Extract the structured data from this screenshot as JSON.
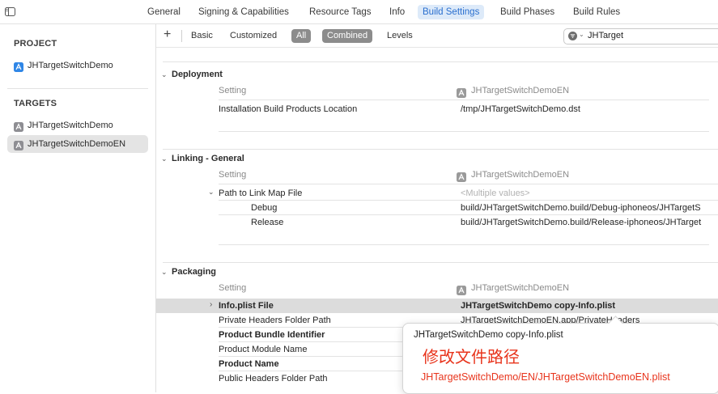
{
  "toolbar": {
    "tabs": [
      {
        "label": "General"
      },
      {
        "label": "Signing & Capabilities"
      },
      {
        "label": "Resource Tags"
      },
      {
        "label": "Info"
      },
      {
        "label": "Build Settings"
      },
      {
        "label": "Build Phases"
      },
      {
        "label": "Build Rules"
      }
    ],
    "active_tab": "Build Settings"
  },
  "sidebar": {
    "project_heading": "PROJECT",
    "project_item": "JHTargetSwitchDemo",
    "targets_heading": "TARGETS",
    "targets": [
      {
        "label": "JHTargetSwitchDemo"
      },
      {
        "label": "JHTargetSwitchDemoEN"
      }
    ],
    "selected_target": "JHTargetSwitchDemoEN"
  },
  "filter": {
    "add_label": "+",
    "basic": "Basic",
    "customized": "Customized",
    "all": "All",
    "combined": "Combined",
    "levels": "Levels",
    "search_value": "JHTarget"
  },
  "sections": {
    "deployment": {
      "title": "Deployment",
      "setting_header": "Setting",
      "target_header": "JHTargetSwitchDemoEN",
      "rows": [
        {
          "name": "Installation Build Products Location",
          "value": "/tmp/JHTargetSwitchDemo.dst"
        }
      ]
    },
    "linking": {
      "title": "Linking - General",
      "setting_header": "Setting",
      "target_header": "JHTargetSwitchDemoEN",
      "rows": [
        {
          "name": "Path to Link Map File",
          "value": "<Multiple values>"
        },
        {
          "name": "Debug",
          "value": "build/JHTargetSwitchDemo.build/Debug-iphoneos/JHTargetS"
        },
        {
          "name": "Release",
          "value": "build/JHTargetSwitchDemo.build/Release-iphoneos/JHTarget"
        }
      ]
    },
    "packaging": {
      "title": "Packaging",
      "setting_header": "Setting",
      "target_header": "JHTargetSwitchDemoEN",
      "rows": [
        {
          "name": "Info.plist File",
          "value": "JHTargetSwitchDemo copy-Info.plist"
        },
        {
          "name": "Private Headers Folder Path",
          "value": "JHTargetSwitchDemoEN.app/PrivateHeaders"
        },
        {
          "name": "Product Bundle Identifier",
          "value": ""
        },
        {
          "name": "Product Module Name",
          "value": ""
        },
        {
          "name": "Product Name",
          "value": ""
        },
        {
          "name": "Public Headers Folder Path",
          "value": ""
        }
      ]
    }
  },
  "popover": {
    "current_value": "JHTargetSwitchDemo copy-Info.plist",
    "annotation": "修改文件路径",
    "new_path": "JHTargetSwitchDemo/EN/JHTargetSwitchDemoEN.plist"
  },
  "colors": {
    "accent": "#2a6fcf",
    "annotation_red": "#e8341c"
  }
}
